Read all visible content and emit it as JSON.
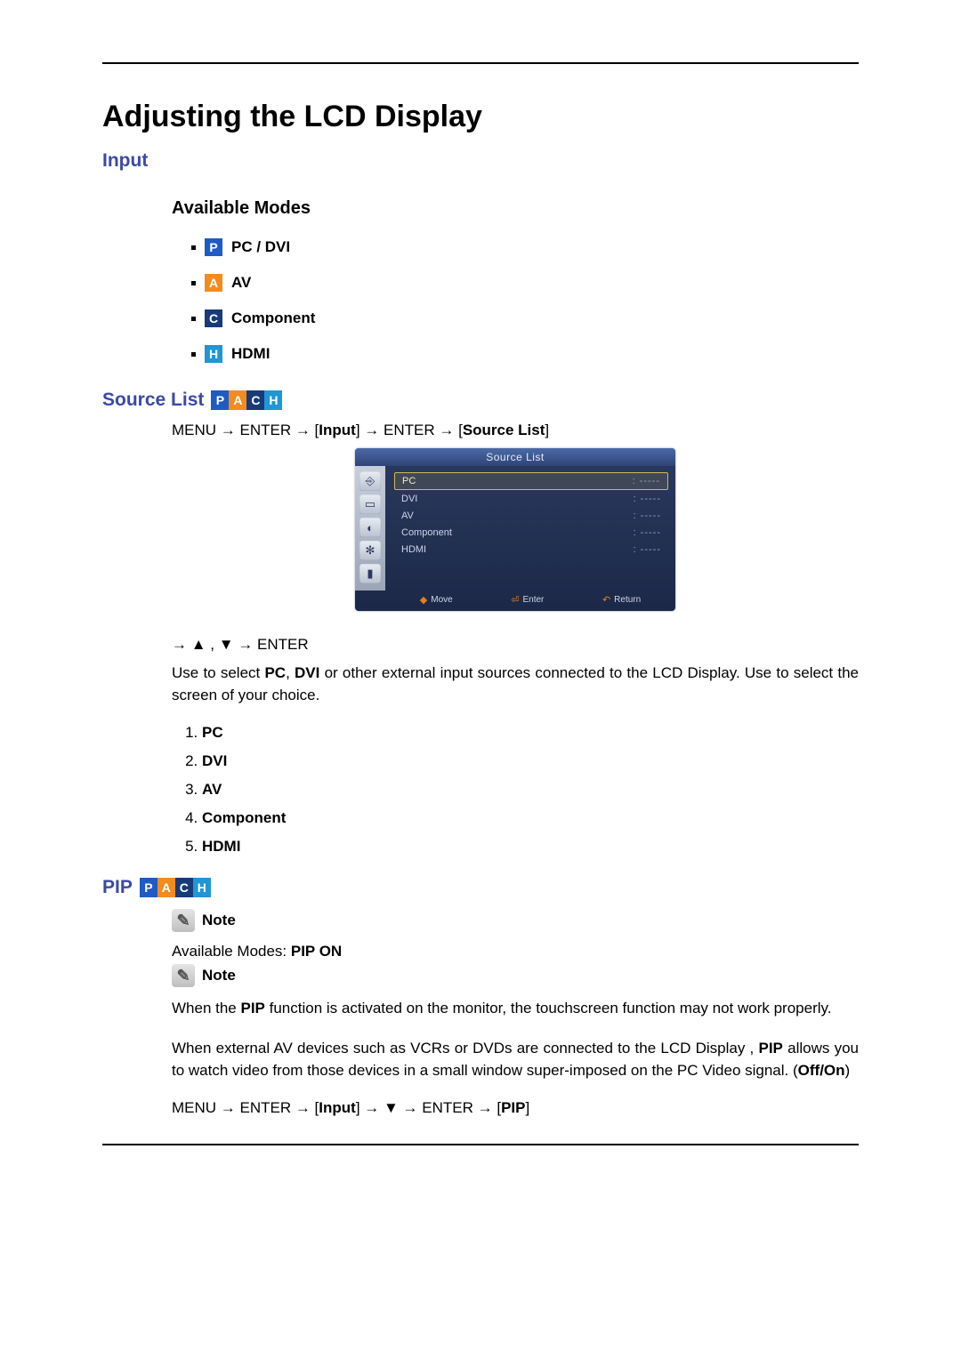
{
  "title": "Adjusting the LCD Display",
  "section_input": "Input",
  "subsection_available_modes": "Available Modes",
  "modes": {
    "p": {
      "letter": "P",
      "label": "PC / DVI"
    },
    "a": {
      "letter": "A",
      "label": "AV"
    },
    "c": {
      "letter": "C",
      "label": "Component"
    },
    "h": {
      "letter": "H",
      "label": "HDMI"
    }
  },
  "section_source_list": "Source List",
  "nav_source_list": {
    "p1": "MENU → ENTER → [",
    "input": "Input",
    "p2": "] → ENTER → [",
    "src": "Source List",
    "p3": "]"
  },
  "osd": {
    "title": "Source List",
    "rows": {
      "r0": {
        "label": "PC",
        "val": ": -----"
      },
      "r1": {
        "label": "DVI",
        "val": ": -----"
      },
      "r2": {
        "label": "AV",
        "val": ": -----"
      },
      "r3": {
        "label": "Component",
        "val": ": -----"
      },
      "r4": {
        "label": "HDMI",
        "val": ": -----"
      }
    },
    "foot": {
      "move": "Move",
      "enter": "Enter",
      "ret": "Return"
    }
  },
  "after_osd_nav": "→ ▲ , ▼ → ENTER",
  "source_list_desc_1": "Use to select ",
  "source_list_desc_pc": "PC",
  "source_list_desc_2": ", ",
  "source_list_desc_dvi": "DVI",
  "source_list_desc_3": " or other external input sources connected to the LCD Display. Use to select the screen of your choice.",
  "list": {
    "i1": "PC",
    "i2": "DVI",
    "i3": "AV",
    "i4": "Component",
    "i5": "HDMI"
  },
  "section_pip": "PIP",
  "note_label": "Note",
  "pip_available_prefix": "Available Modes: ",
  "pip_available_bold": "PIP ON",
  "pip_note_text": {
    "a1": "When the ",
    "b1": "PIP",
    "a2": " function is activated on the monitor, the touchscreen function may not work properly."
  },
  "pip_desc": {
    "a1": "When external AV devices such as VCRs or DVDs are connected to the LCD Display , ",
    "b1": "PIP",
    "a2": " allows you to watch video from those devices in a small window super-imposed on the PC Video signal. (",
    "b2": "Off/On",
    "a3": ")"
  },
  "nav_pip": {
    "p1": "MENU → ENTER → [",
    "input": "Input",
    "p2": "] → ▼ → ENTER → [",
    "pip": "PIP",
    "p3": "]"
  }
}
